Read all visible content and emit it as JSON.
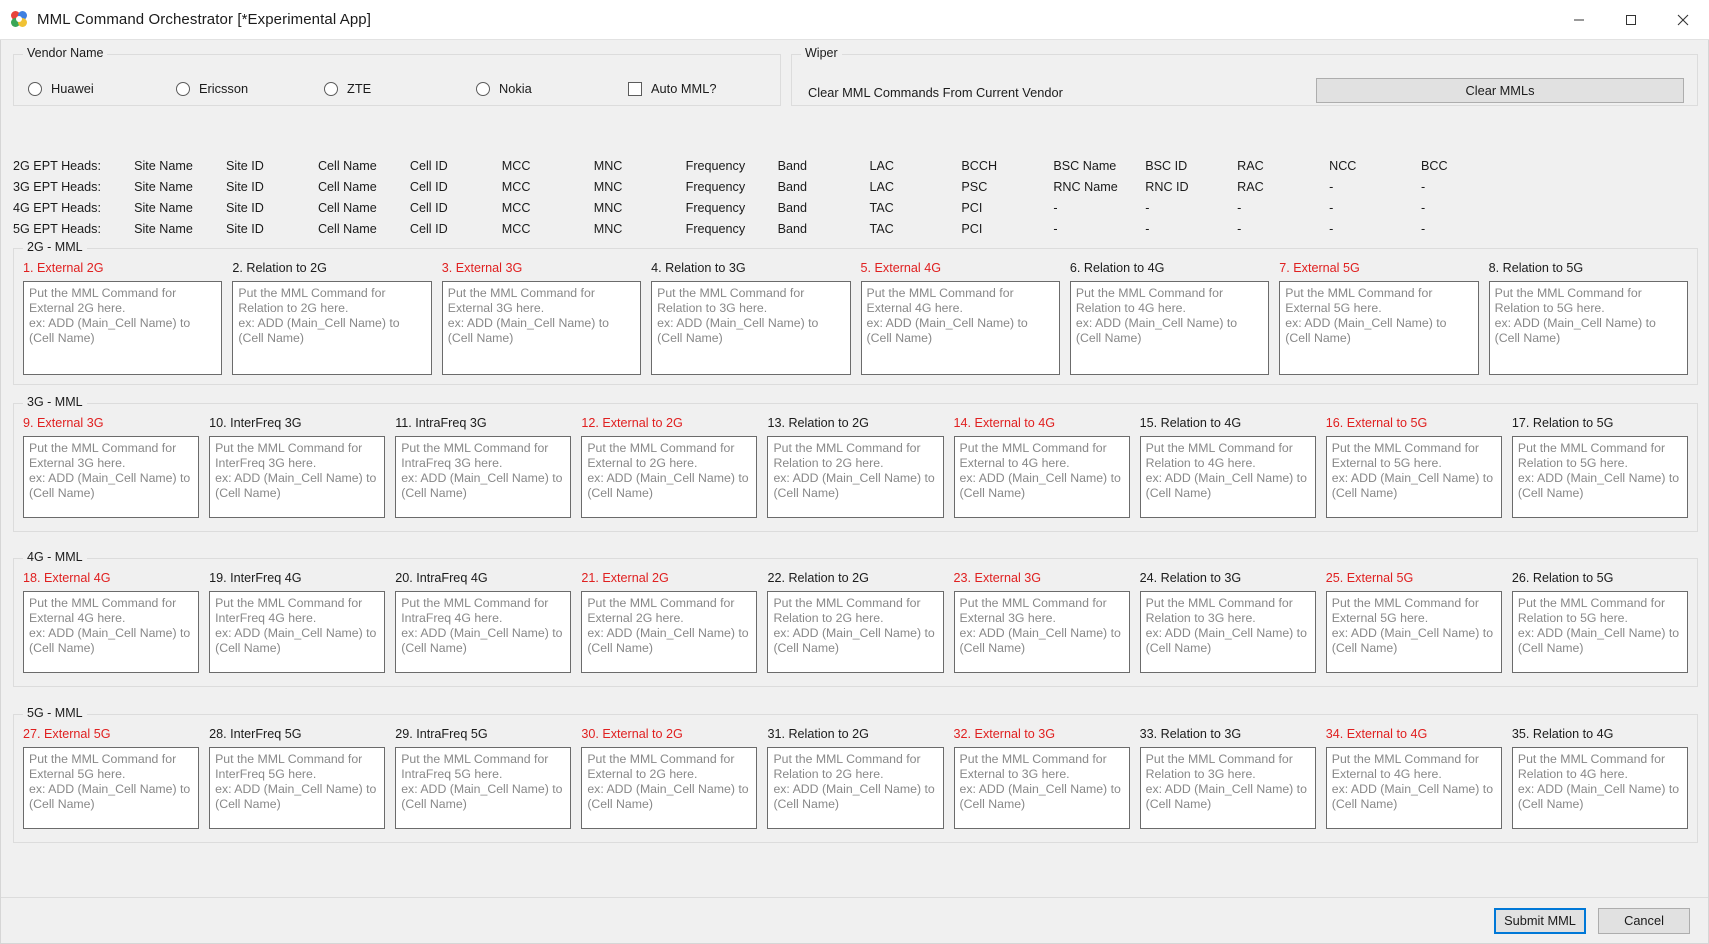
{
  "window": {
    "title": "MML Command Orchestrator [*Experimental App]",
    "app_icon": "chrome-like-icon",
    "minimize": "minimize-icon",
    "maximize": "maximize-icon",
    "close": "close-icon"
  },
  "vendor": {
    "legend": "Vendor Name",
    "options": [
      {
        "label": "Huawei",
        "selected": false
      },
      {
        "label": "Ericsson",
        "selected": false
      },
      {
        "label": "ZTE",
        "selected": false
      },
      {
        "label": "Nokia",
        "selected": false
      }
    ],
    "auto_mml": {
      "label": "Auto MML?",
      "checked": false
    }
  },
  "wiper": {
    "legend": "Wiper",
    "description": "Clear MML Commands From Current Vendor",
    "clear_button": "Clear MMLs"
  },
  "ept_heads": {
    "rows": [
      {
        "lead": "2G EPT Heads:",
        "cells": [
          "Site Name",
          "Site ID",
          "Cell Name",
          "Cell ID",
          "MCC",
          "MNC",
          "Frequency",
          "Band",
          "LAC",
          "BCCH",
          "BSC Name",
          "BSC ID",
          "RAC",
          "NCC",
          "BCC"
        ]
      },
      {
        "lead": "3G EPT Heads:",
        "cells": [
          "Site Name",
          "Site ID",
          "Cell Name",
          "Cell ID",
          "MCC",
          "MNC",
          "Frequency",
          "Band",
          "LAC",
          "PSC",
          "RNC Name",
          "RNC ID",
          "RAC",
          "-",
          "-"
        ]
      },
      {
        "lead": "4G EPT Heads:",
        "cells": [
          "Site Name",
          "Site ID",
          "Cell Name",
          "Cell ID",
          "MCC",
          "MNC",
          "Frequency",
          "Band",
          "TAC",
          "PCI",
          "-",
          "-",
          "-",
          "-",
          "-"
        ]
      },
      {
        "lead": "5G EPT Heads:",
        "cells": [
          "Site Name",
          "Site ID",
          "Cell Name",
          "Cell ID",
          "MCC",
          "MNC",
          "Frequency",
          "Band",
          "TAC",
          "PCI",
          "-",
          "-",
          "-",
          "-",
          "-"
        ]
      }
    ]
  },
  "sections": [
    {
      "legend": "2G - MML",
      "cells": [
        {
          "label": "1. External 2G",
          "external": true,
          "placeholder": "Put the MML Command for External 2G here.\nex: ADD (Main_Cell Name) to (Cell Name)"
        },
        {
          "label": "2. Relation to 2G",
          "external": false,
          "placeholder": "Put the MML Command for Relation to 2G here.\nex: ADD (Main_Cell Name) to (Cell Name)"
        },
        {
          "label": "3. External 3G",
          "external": true,
          "placeholder": "Put the MML Command for External 3G here.\nex: ADD (Main_Cell Name) to (Cell Name)"
        },
        {
          "label": "4. Relation to 3G",
          "external": false,
          "placeholder": "Put the MML Command for Relation to 3G here.\nex: ADD (Main_Cell Name) to (Cell Name)"
        },
        {
          "label": "5. External 4G",
          "external": true,
          "placeholder": "Put the MML Command for External 4G here.\nex: ADD (Main_Cell Name) to (Cell Name)"
        },
        {
          "label": "6. Relation to 4G",
          "external": false,
          "placeholder": "Put the MML Command for Relation to 4G here.\nex: ADD (Main_Cell Name) to (Cell Name)"
        },
        {
          "label": "7. External 5G",
          "external": true,
          "placeholder": "Put the MML Command for External 5G here.\nex: ADD (Main_Cell Name) to (Cell Name)"
        },
        {
          "label": "8. Relation to 5G",
          "external": false,
          "placeholder": "Put the MML Command for Relation to 5G here.\nex: ADD (Main_Cell Name) to (Cell Name)"
        }
      ]
    },
    {
      "legend": "3G - MML",
      "cells": [
        {
          "label": "9. External 3G",
          "external": true,
          "placeholder": "Put the MML Command for External 3G here.\nex: ADD (Main_Cell Name) to (Cell Name)"
        },
        {
          "label": "10. InterFreq 3G",
          "external": false,
          "placeholder": "Put the MML Command for InterFreq 3G here.\nex: ADD (Main_Cell Name) to (Cell Name)"
        },
        {
          "label": "11. IntraFreq 3G",
          "external": false,
          "placeholder": "Put the MML Command for IntraFreq 3G here.\nex: ADD (Main_Cell Name) to (Cell Name)"
        },
        {
          "label": "12. External to 2G",
          "external": true,
          "placeholder": "Put the MML Command for External to 2G here.\nex: ADD (Main_Cell Name) to (Cell Name)"
        },
        {
          "label": "13. Relation to 2G",
          "external": false,
          "placeholder": "Put the MML Command for Relation to 2G here.\nex: ADD (Main_Cell Name) to (Cell Name)"
        },
        {
          "label": "14. External to 4G",
          "external": true,
          "placeholder": "Put the MML Command for External to 4G here.\nex: ADD (Main_Cell Name) to (Cell Name)"
        },
        {
          "label": "15. Relation to 4G",
          "external": false,
          "placeholder": "Put the MML Command for Relation to 4G here.\nex: ADD (Main_Cell Name) to (Cell Name)"
        },
        {
          "label": "16. External to 5G",
          "external": true,
          "placeholder": "Put the MML Command for External to 5G here.\nex: ADD (Main_Cell Name) to (Cell Name)"
        },
        {
          "label": "17. Relation to 5G",
          "external": false,
          "placeholder": "Put the MML Command for Relation to 5G here.\nex: ADD (Main_Cell Name) to (Cell Name)"
        }
      ]
    },
    {
      "legend": "4G - MML",
      "cells": [
        {
          "label": "18. External 4G",
          "external": true,
          "placeholder": "Put the MML Command for External 4G here.\nex: ADD (Main_Cell Name) to (Cell Name)"
        },
        {
          "label": "19. InterFreq 4G",
          "external": false,
          "placeholder": "Put the MML Command for InterFreq 4G here.\nex: ADD (Main_Cell Name) to (Cell Name)"
        },
        {
          "label": "20. IntraFreq 4G",
          "external": false,
          "placeholder": "Put the MML Command for IntraFreq 4G here.\nex: ADD (Main_Cell Name) to (Cell Name)"
        },
        {
          "label": "21. External 2G",
          "external": true,
          "placeholder": "Put the MML Command for External 2G here.\nex: ADD (Main_Cell Name) to (Cell Name)"
        },
        {
          "label": "22. Relation to 2G",
          "external": false,
          "placeholder": "Put the MML Command for Relation to 2G here.\nex: ADD (Main_Cell Name) to (Cell Name)"
        },
        {
          "label": "23. External 3G",
          "external": true,
          "placeholder": "Put the MML Command for External 3G here.\nex: ADD (Main_Cell Name) to (Cell Name)"
        },
        {
          "label": "24. Relation to 3G",
          "external": false,
          "placeholder": "Put the MML Command for Relation to 3G here.\nex: ADD (Main_Cell Name) to (Cell Name)"
        },
        {
          "label": "25. External 5G",
          "external": true,
          "placeholder": "Put the MML Command for External 5G here.\nex: ADD (Main_Cell Name) to (Cell Name)"
        },
        {
          "label": "26. Relation to 5G",
          "external": false,
          "placeholder": "Put the MML Command for Relation to 5G here.\nex: ADD (Main_Cell Name) to (Cell Name)"
        }
      ]
    },
    {
      "legend": "5G - MML",
      "cells": [
        {
          "label": "27. External 5G",
          "external": true,
          "placeholder": "Put the MML Command for External 5G here.\nex: ADD (Main_Cell Name) to (Cell Name)"
        },
        {
          "label": "28. InterFreq 5G",
          "external": false,
          "placeholder": "Put the MML Command for InterFreq 5G here.\nex: ADD (Main_Cell Name) to (Cell Name)"
        },
        {
          "label": "29. IntraFreq 5G",
          "external": false,
          "placeholder": "Put the MML Command for IntraFreq 5G here.\nex: ADD (Main_Cell Name) to (Cell Name)"
        },
        {
          "label": "30. External to 2G",
          "external": true,
          "placeholder": "Put the MML Command for External to 2G here.\nex: ADD (Main_Cell Name) to (Cell Name)"
        },
        {
          "label": "31. Relation to 2G",
          "external": false,
          "placeholder": "Put the MML Command for Relation to 2G here.\nex: ADD (Main_Cell Name) to (Cell Name)"
        },
        {
          "label": "32. External to 3G",
          "external": true,
          "placeholder": "Put the MML Command for External to 3G here.\nex: ADD (Main_Cell Name) to (Cell Name)"
        },
        {
          "label": "33. Relation to 3G",
          "external": false,
          "placeholder": "Put the MML Command for Relation to 3G here.\nex: ADD (Main_Cell Name) to (Cell Name)"
        },
        {
          "label": "34. External to 4G",
          "external": true,
          "placeholder": "Put the MML Command for External to 4G here.\nex: ADD (Main_Cell Name) to (Cell Name)"
        },
        {
          "label": "35. Relation to 4G",
          "external": false,
          "placeholder": "Put the MML Command for Relation to 4G here.\nex: ADD (Main_Cell Name) to (Cell Name)"
        }
      ]
    }
  ],
  "footer": {
    "submit": "Submit MML",
    "cancel": "Cancel"
  },
  "colors": {
    "external_label": "#e02020",
    "focus_border": "#0078d7",
    "window_bg": "#f0f0f0"
  }
}
